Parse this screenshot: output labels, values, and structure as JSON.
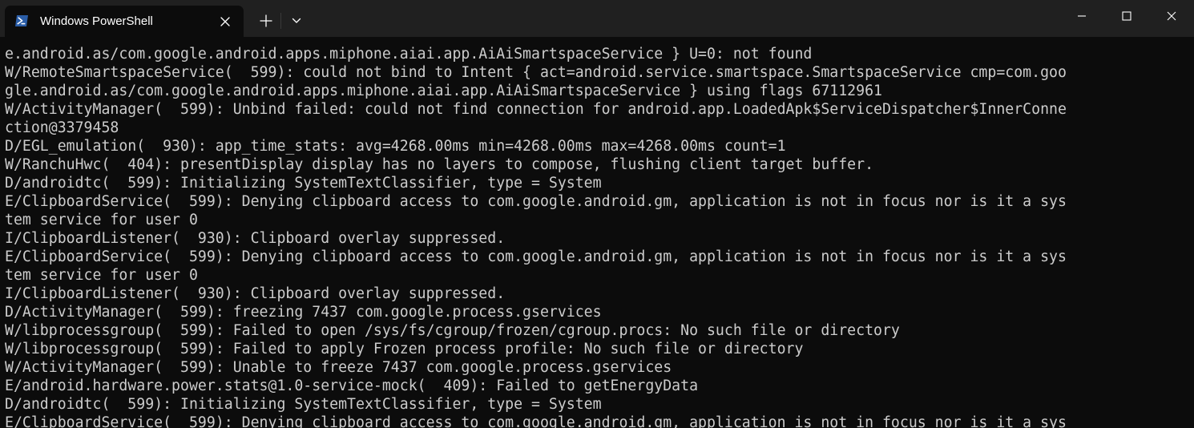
{
  "window": {
    "tab_title": "Windows PowerShell",
    "tab_icon": "powershell-icon",
    "close_tab_icon": "close-icon",
    "new_tab_icon": "plus-icon",
    "dropdown_icon": "chevron-down-icon",
    "minimize_icon": "minimize-icon",
    "maximize_icon": "maximize-icon",
    "close_window_icon": "close-icon"
  },
  "colors": {
    "titlebar": "#202020",
    "terminal_bg": "#0c0c0c",
    "terminal_text": "#cccccc",
    "powershell_blue": "#2b5ea8"
  },
  "terminal": {
    "lines": [
      "e.android.as/com.google.android.apps.miphone.aiai.app.AiAiSmartspaceService } U=0: not found",
      "W/RemoteSmartspaceService(  599): could not bind to Intent { act=android.service.smartspace.SmartspaceService cmp=com.goo",
      "gle.android.as/com.google.android.apps.miphone.aiai.app.AiAiSmartspaceService } using flags 67112961",
      "W/ActivityManager(  599): Unbind failed: could not find connection for android.app.LoadedApk$ServiceDispatcher$InnerConne",
      "ction@3379458",
      "D/EGL_emulation(  930): app_time_stats: avg=4268.00ms min=4268.00ms max=4268.00ms count=1",
      "W/RanchuHwc(  404): presentDisplay display has no layers to compose, flushing client target buffer.",
      "D/androidtc(  599): Initializing SystemTextClassifier, type = System",
      "E/ClipboardService(  599): Denying clipboard access to com.google.android.gm, application is not in focus nor is it a sys",
      "tem service for user 0",
      "I/ClipboardListener(  930): Clipboard overlay suppressed.",
      "E/ClipboardService(  599): Denying clipboard access to com.google.android.gm, application is not in focus nor is it a sys",
      "tem service for user 0",
      "I/ClipboardListener(  930): Clipboard overlay suppressed.",
      "D/ActivityManager(  599): freezing 7437 com.google.process.gservices",
      "W/libprocessgroup(  599): Failed to open /sys/fs/cgroup/frozen/cgroup.procs: No such file or directory",
      "W/libprocessgroup(  599): Failed to apply Frozen process profile: No such file or directory",
      "W/ActivityManager(  599): Unable to freeze 7437 com.google.process.gservices",
      "E/android.hardware.power.stats@1.0-service-mock(  409): Failed to getEnergyData",
      "D/androidtc(  599): Initializing SystemTextClassifier, type = System",
      "E/ClipboardService(  599): Denying clipboard access to com.google.android.gm, application is not in focus nor is it a sys"
    ]
  }
}
